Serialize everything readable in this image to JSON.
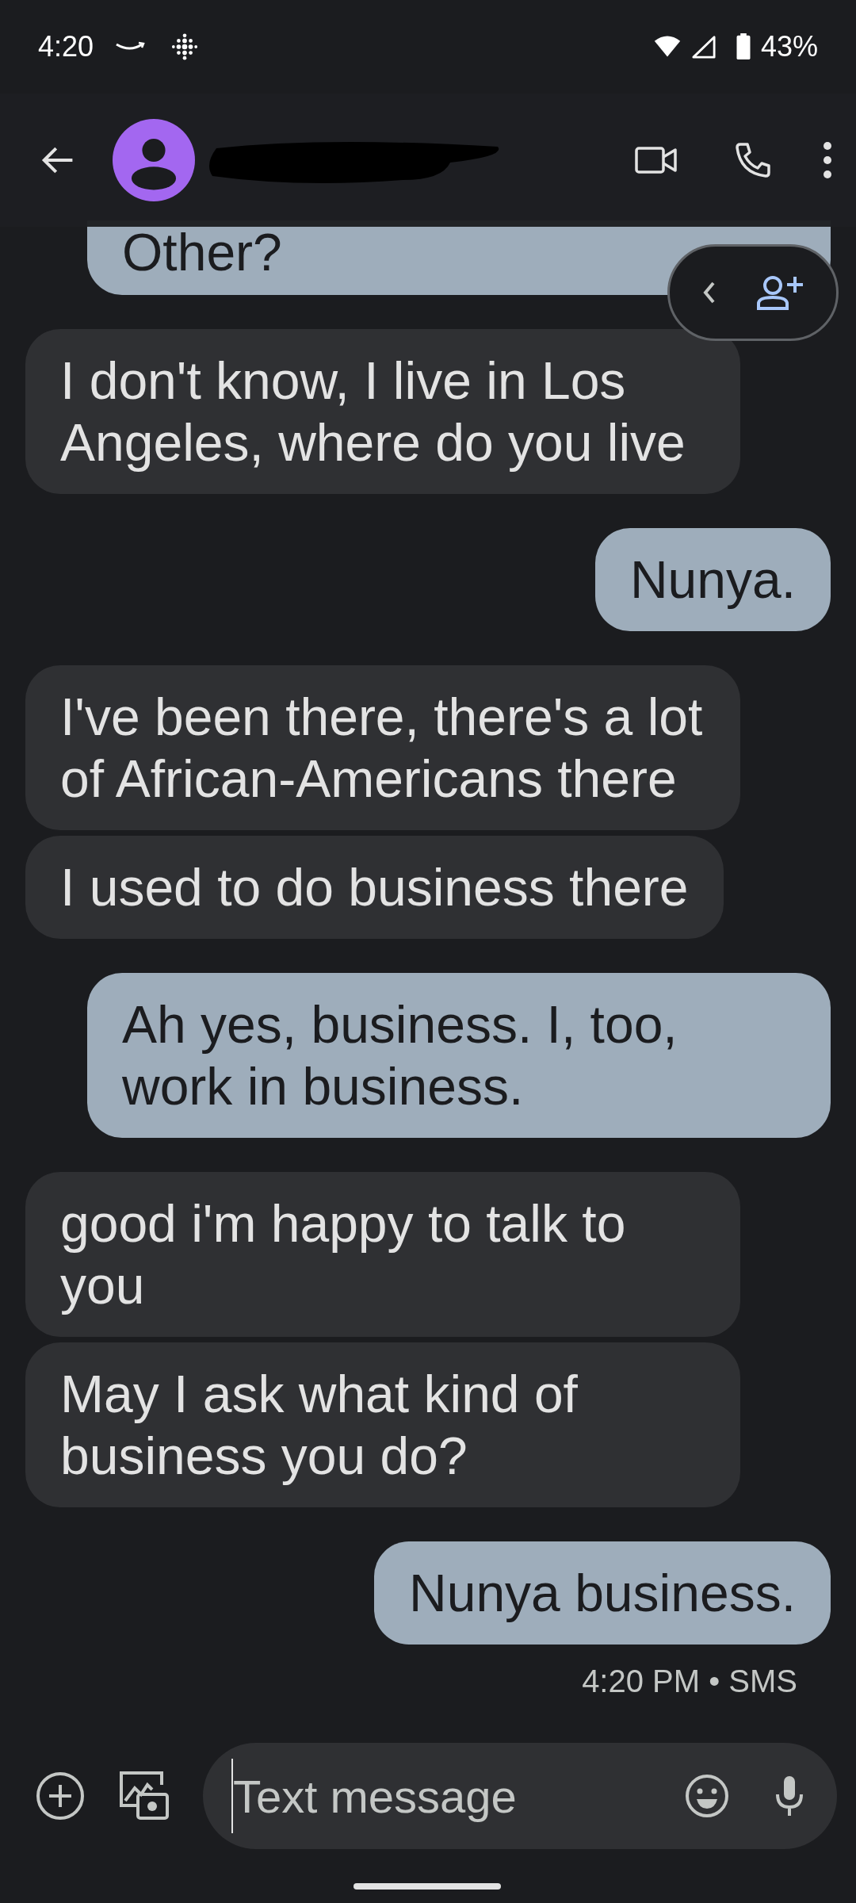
{
  "status_bar": {
    "time": "4:20",
    "battery": "43%"
  },
  "messages": [
    {
      "kind": "sent",
      "text": "Other?"
    },
    {
      "kind": "received",
      "text": "I don't know, I live in Los Angeles, where do you live"
    },
    {
      "kind": "sent",
      "text": "Nunya."
    },
    {
      "kind": "received",
      "text": "I've been there, there's a lot of African-Americans there"
    },
    {
      "kind": "received",
      "text": "I used to do business there"
    },
    {
      "kind": "sent",
      "text": "Ah yes, business. I, too, work in business."
    },
    {
      "kind": "received",
      "text": "good i'm happy to talk to you"
    },
    {
      "kind": "received",
      "text": "May I ask what kind of business you do?"
    },
    {
      "kind": "sent",
      "text": "Nunya business."
    }
  ],
  "message_meta": "4:20 PM • SMS",
  "composer": {
    "placeholder": "Text message"
  }
}
